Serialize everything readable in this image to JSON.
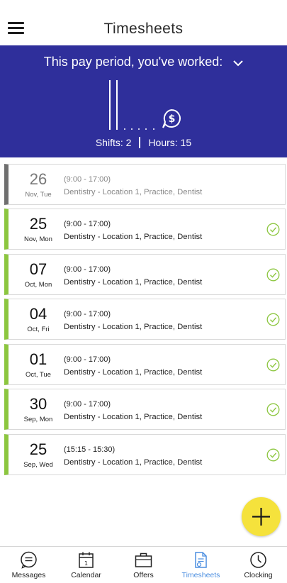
{
  "header": {
    "title": "Timesheets"
  },
  "summary": {
    "heading": "This pay period, you've worked:",
    "shifts": "Shifts: 2",
    "hours": "Hours: 15"
  },
  "timesheets": [
    {
      "day": "26",
      "month": "Nov, Tue",
      "time": "(9:00 - 17:00)",
      "location": "Dentistry - Location 1, Practice, Dentist",
      "status": "pending"
    },
    {
      "day": "25",
      "month": "Nov, Mon",
      "time": "(9:00 - 17:00)",
      "location": "Dentistry - Location 1, Practice, Dentist",
      "status": "approved"
    },
    {
      "day": "07",
      "month": "Oct, Mon",
      "time": "(9:00 - 17:00)",
      "location": "Dentistry - Location 1, Practice, Dentist",
      "status": "approved"
    },
    {
      "day": "04",
      "month": "Oct, Fri",
      "time": "(9:00 - 17:00)",
      "location": "Dentistry - Location 1, Practice, Dentist",
      "status": "approved"
    },
    {
      "day": "01",
      "month": "Oct, Tue",
      "time": "(9:00 - 17:00)",
      "location": "Dentistry - Location 1, Practice, Dentist",
      "status": "approved"
    },
    {
      "day": "30",
      "month": "Sep, Mon",
      "time": "(9:00 - 17:00)",
      "location": "Dentistry - Location 1, Practice, Dentist",
      "status": "approved"
    },
    {
      "day": "25",
      "month": "Sep, Wed",
      "time": "(15:15 - 15:30)",
      "location": "Dentistry - Location 1, Practice, Dentist",
      "status": "approved"
    }
  ],
  "tabs": [
    {
      "label": "Messages",
      "icon": "messages-icon"
    },
    {
      "label": "Calendar",
      "icon": "calendar-icon"
    },
    {
      "label": "Offers",
      "icon": "briefcase-icon"
    },
    {
      "label": "Timesheets",
      "icon": "timesheet-icon"
    },
    {
      "label": "Clocking",
      "icon": "clock-icon"
    }
  ],
  "colors": {
    "summary_bg": "#2f2f9b",
    "approved": "#8cc63f",
    "pending": "#6f6f6f",
    "fab": "#f5e23c",
    "active_tab": "#4b8ee0"
  }
}
